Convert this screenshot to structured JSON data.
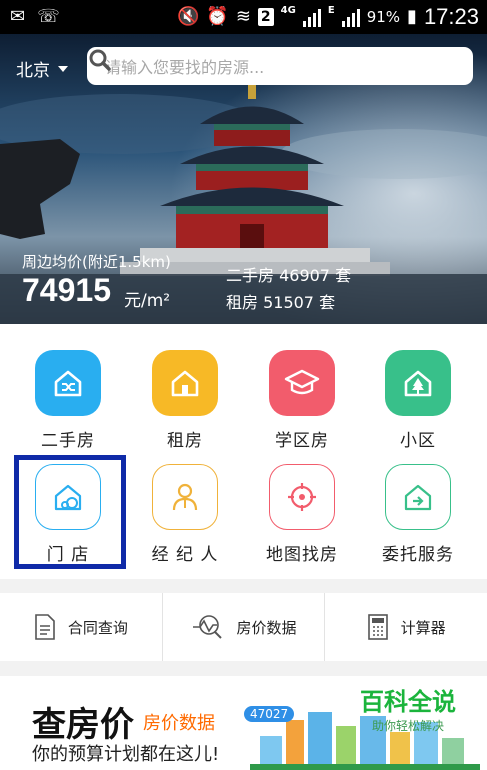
{
  "status_bar": {
    "network": "4G",
    "sim": "2",
    "sim2_letter": "E",
    "battery": "91%",
    "time": "17:23"
  },
  "header": {
    "city": "北京",
    "search_placeholder": "请输入您要找的房源..."
  },
  "hero": {
    "avg_label": "周边均价(附近1.5km)",
    "avg_value": "74915",
    "avg_unit": "元/m²",
    "secondhand_stat": "二手房 46907 套",
    "rent_stat": "租房 51507 套"
  },
  "grid": {
    "row1": [
      {
        "label": "二手房",
        "icon": "shuffle-house-icon",
        "color": "#29aef0"
      },
      {
        "label": "租房",
        "icon": "house-icon",
        "color": "#f7b926"
      },
      {
        "label": "学区房",
        "icon": "graduation-cap-icon",
        "color": "#f25c6c"
      },
      {
        "label": "小区",
        "icon": "tree-house-icon",
        "color": "#38c08a"
      }
    ],
    "row2": [
      {
        "label": "门 店",
        "icon": "store-house-icon",
        "color": "#29aef0"
      },
      {
        "label": "经 纪 人",
        "icon": "agent-icon",
        "color": "#f0b23a"
      },
      {
        "label": "地图找房",
        "icon": "map-target-icon",
        "color": "#f25c6c"
      },
      {
        "label": "委托服务",
        "icon": "entrust-house-icon",
        "color": "#38c08a"
      }
    ]
  },
  "tools": [
    {
      "label": "合同查询",
      "icon": "contract-doc-icon"
    },
    {
      "label": "房价数据",
      "icon": "price-chart-icon"
    },
    {
      "label": "计算器",
      "icon": "calculator-icon"
    }
  ],
  "banner": {
    "title": "查房价",
    "subtitle": "房价数据",
    "description": "你的预算计划都在这儿!",
    "badge": "47027",
    "watermark_big": "百科全说",
    "watermark_small": "助你轻松解决"
  }
}
